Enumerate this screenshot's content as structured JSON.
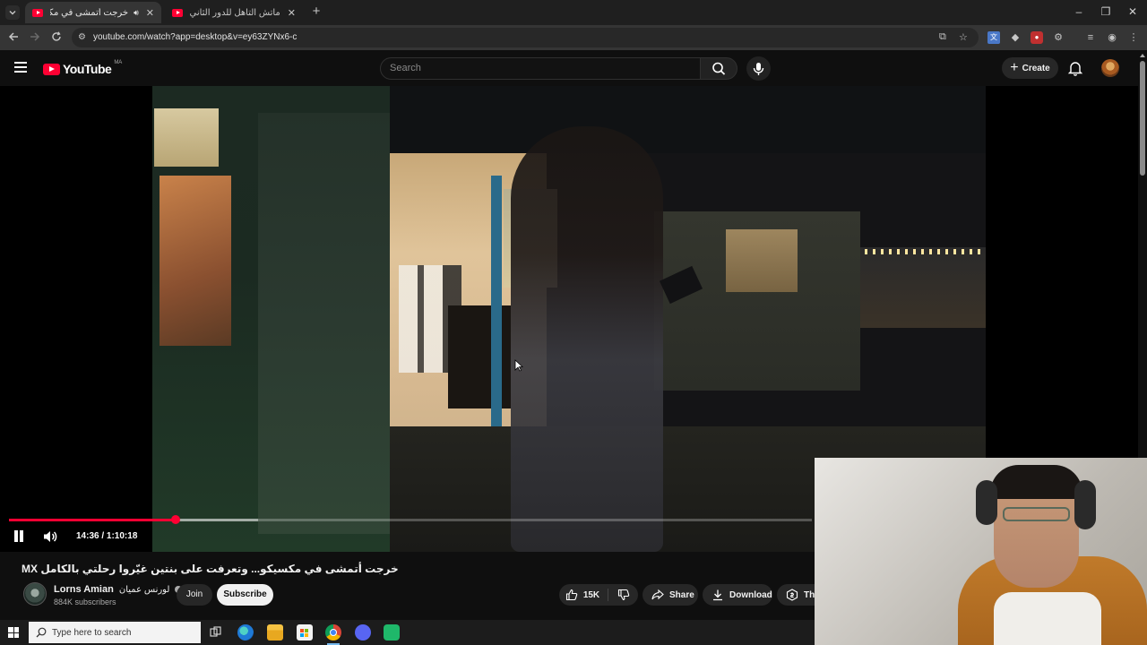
{
  "browser": {
    "tabs": [
      {
        "title": "خرجت أتمشى في مكسيكو...",
        "active": true,
        "audio": true
      },
      {
        "title": "ماتش التأهل للدور الثاني؟ التشك",
        "active": false,
        "audio": false
      }
    ],
    "new_tab_icon": "plus-icon",
    "url": "youtube.com/watch?app=desktop&v=ey63ZYNx6-c"
  },
  "youtube": {
    "logo_text": "YouTube",
    "region": "MA",
    "search_placeholder": "Search",
    "create_label": "Create"
  },
  "player": {
    "progress_fraction": 0.2072,
    "buffered_fraction": 0.31,
    "time_display": "14:36 / 1:10:18",
    "state": "playing"
  },
  "video": {
    "title": "خرجت أتمشى في مكسيكو... وتعرفت على بنتين غيّروا رحلتي بالكامل MX",
    "channel": {
      "name": "Lorns Amian",
      "name_ar": "لورنس عميان",
      "subscribers": "884K subscribers",
      "join_label": "Join",
      "subscribe_label": "Subscribe"
    },
    "actions": {
      "likes": "15K",
      "share_label": "Share",
      "download_label": "Download",
      "thanks_label": "Thanks"
    }
  },
  "taskbar": {
    "search_placeholder": "Type here to search"
  },
  "colors": {
    "youtube_red": "#ff0033",
    "page_bg": "#0f0f0f",
    "pill_bg": "#272727"
  }
}
